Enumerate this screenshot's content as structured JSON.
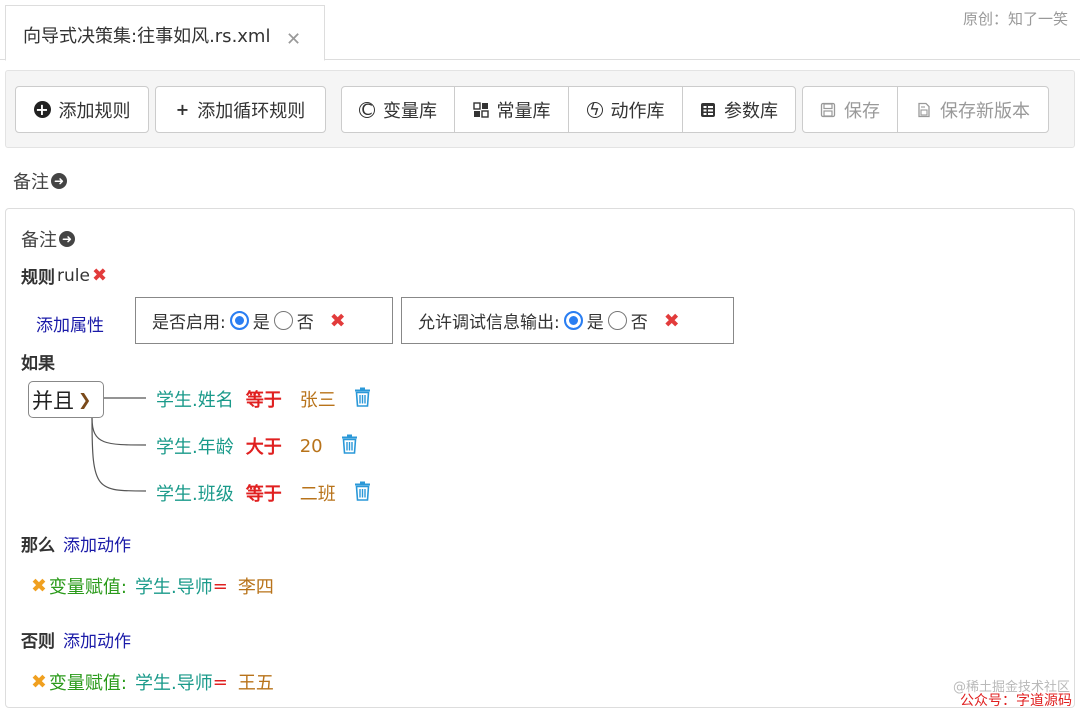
{
  "tab": {
    "title": "向导式决策集:往事如风.rs.xml",
    "close": "✕"
  },
  "author": "原创：知了一笑",
  "toolbar": {
    "add_rule": "添加规则",
    "add_loop_rule": "添加循环规则",
    "variable_lib": "变量库",
    "constant_lib": "常量库",
    "action_lib": "动作库",
    "parameter_lib": "参数库",
    "save": "保存",
    "save_new_version": "保存新版本"
  },
  "remark_outer": "备注",
  "rule": {
    "remark": "备注",
    "label": "规则",
    "name": "rule",
    "add_attribute": "添加属性",
    "enabled": {
      "label": "是否启用:",
      "yes": "是",
      "no": "否",
      "selected": "是"
    },
    "debug": {
      "label": "允许调试信息输出:",
      "yes": "是",
      "no": "否",
      "selected": "是"
    },
    "if_label": "如果",
    "join": "并且",
    "conditions": [
      {
        "variable": "学生.姓名",
        "operator": "等于",
        "value": "张三"
      },
      {
        "variable": "学生.年龄",
        "operator": "大于",
        "value": "20"
      },
      {
        "variable": "学生.班级",
        "operator": "等于",
        "value": "二班"
      }
    ],
    "then_label": "那么",
    "else_label": "否则",
    "add_action": "添加动作",
    "then_action": {
      "type": "变量赋值:",
      "variable": "学生.导师",
      "eq": "=",
      "value": "李四"
    },
    "else_action": {
      "type": "变量赋值:",
      "variable": "学生.导师",
      "eq": "=",
      "value": "王五"
    }
  },
  "watermark": {
    "line1": "@稀土掘金技术社区",
    "line2": "公众号：字道源码"
  },
  "colors": {
    "variable": "#1a9a8a",
    "operator": "#e02020",
    "value": "#b8731a",
    "link": "#1a1aa8",
    "radio_on": "#2a7ef2"
  }
}
